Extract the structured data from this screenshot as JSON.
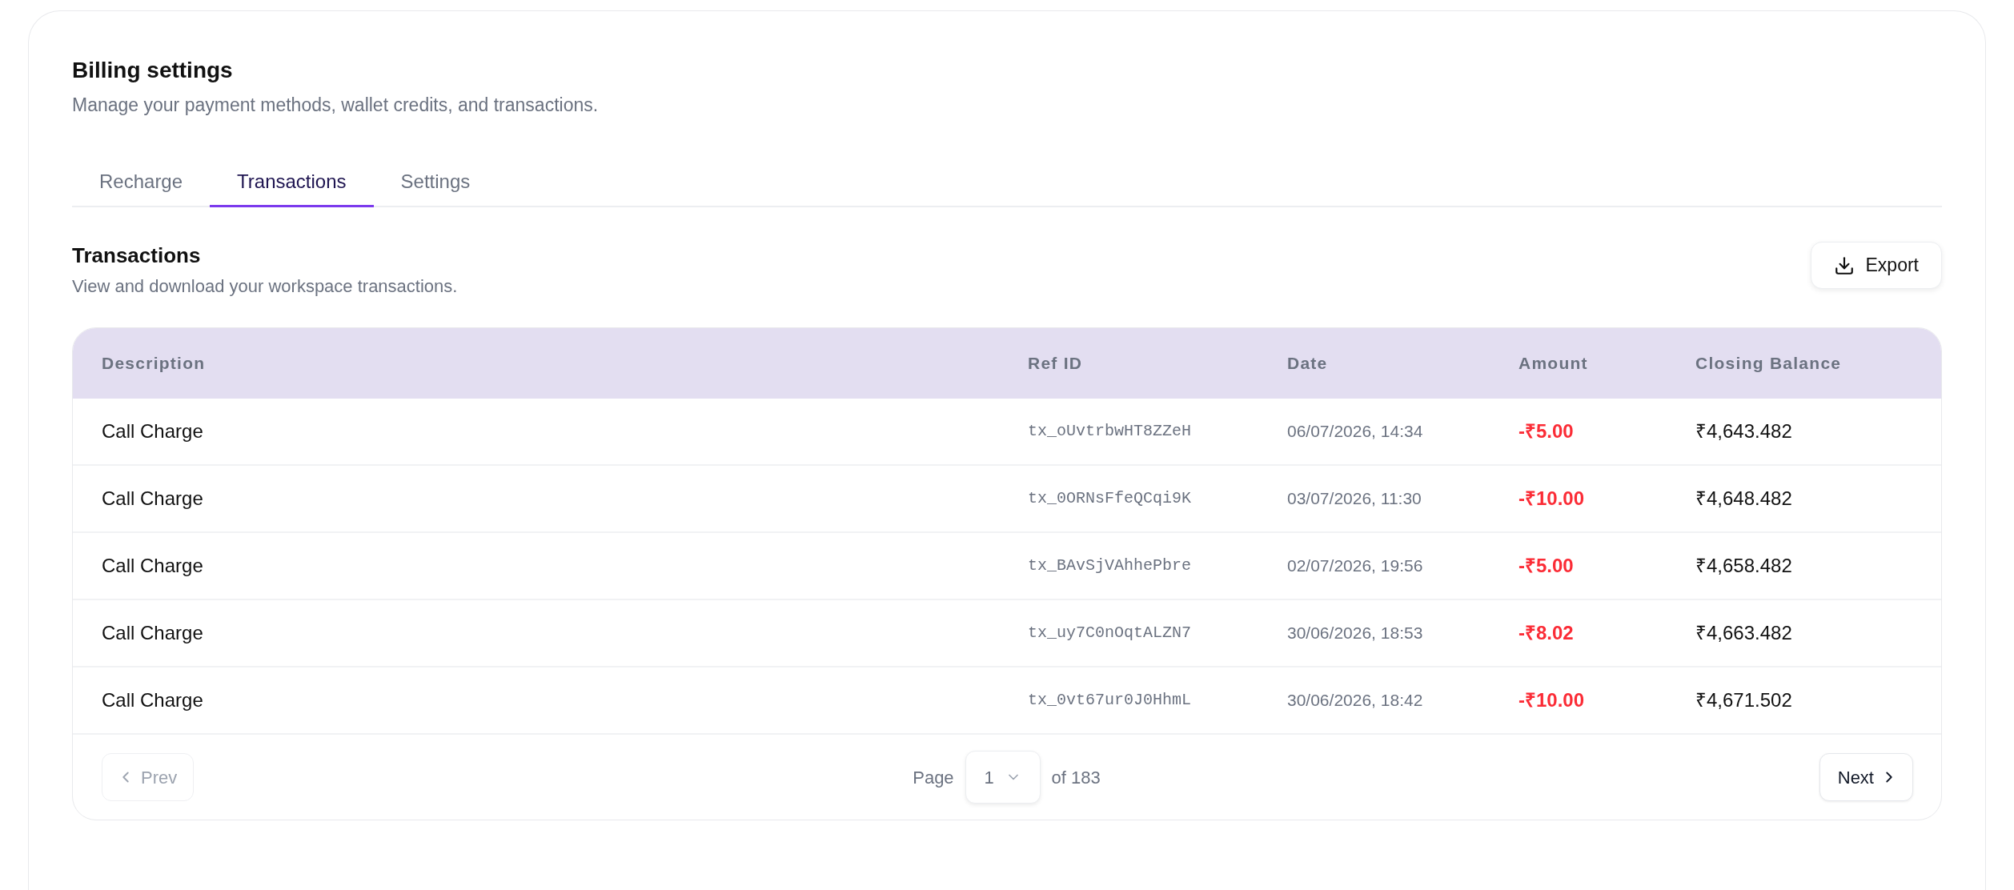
{
  "page": {
    "title": "Billing settings",
    "subtitle": "Manage your payment methods, wallet credits, and transactions."
  },
  "tabs": [
    {
      "label": "Recharge",
      "selected": false
    },
    {
      "label": "Transactions",
      "selected": true
    },
    {
      "label": "Settings",
      "selected": false
    }
  ],
  "section": {
    "title": "Transactions",
    "subtitle": "View and download your workspace transactions.",
    "export_button": "Export"
  },
  "table": {
    "columns": [
      "Description",
      "Ref ID",
      "Date",
      "Amount",
      "Closing Balance"
    ],
    "rows": [
      {
        "description": "Call Charge",
        "ref_id": "tx_oUvtrbwHT8ZZeH",
        "date": "06/07/2026, 14:34",
        "amount": "-₹5.00",
        "closing_balance": "₹4,643.482"
      },
      {
        "description": "Call Charge",
        "ref_id": "tx_0ORNsFfeQCqi9K",
        "date": "03/07/2026, 11:30",
        "amount": "-₹10.00",
        "closing_balance": "₹4,648.482"
      },
      {
        "description": "Call Charge",
        "ref_id": "tx_BAvSjVAhhePbre",
        "date": "02/07/2026, 19:56",
        "amount": "-₹5.00",
        "closing_balance": "₹4,658.482"
      },
      {
        "description": "Call Charge",
        "ref_id": "tx_uy7C0nOqtALZN7",
        "date": "30/06/2026, 18:53",
        "amount": "-₹8.02",
        "closing_balance": "₹4,663.482"
      },
      {
        "description": "Call Charge",
        "ref_id": "tx_0vt67ur0J0HhmL",
        "date": "30/06/2026, 18:42",
        "amount": "-₹10.00",
        "closing_balance": "₹4,671.502"
      }
    ]
  },
  "pagination": {
    "prev": {
      "label": "Prev",
      "disabled": true
    },
    "page_label": "Page",
    "page": "1",
    "of_label": "of 183",
    "next": {
      "label": "Next",
      "disabled": false
    }
  }
}
